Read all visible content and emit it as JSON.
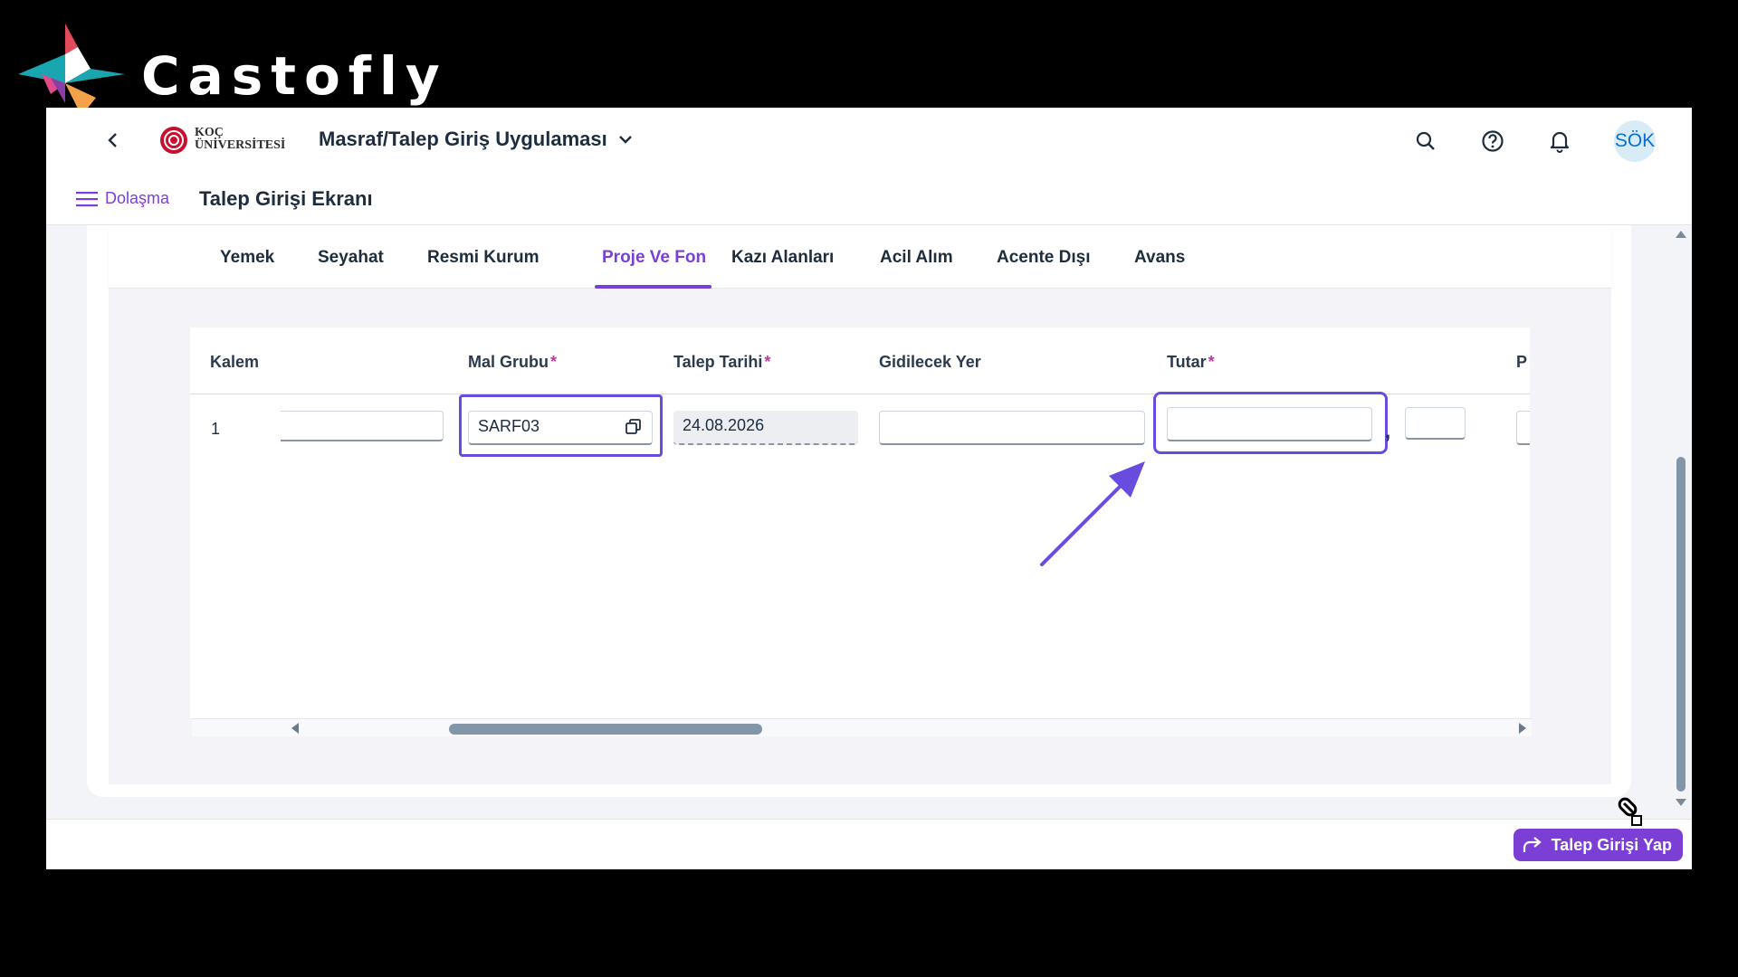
{
  "brand": {
    "name": "Castofly"
  },
  "shellbar": {
    "logo_text_line1": "KOÇ",
    "logo_text_line2": "ÜNİVERSİTESİ",
    "app_title": "Masraf/Talep Giriş Uygulaması",
    "avatar_initials": "SÖK",
    "icons": [
      "back-icon",
      "search-icon",
      "help-icon",
      "bell-icon",
      "chevron-down-icon"
    ]
  },
  "subbar": {
    "nav_label": "Dolaşma",
    "page_title": "Talep Girişi Ekranı"
  },
  "tabs": [
    {
      "label": "Yemek",
      "active": false
    },
    {
      "label": "Seyahat",
      "active": false
    },
    {
      "label": "Resmi Kurum",
      "active": false
    },
    {
      "label": "Proje Ve Fon",
      "active": true
    },
    {
      "label": "Kazı Alanları",
      "active": false
    },
    {
      "label": "Acil Alım",
      "active": false
    },
    {
      "label": "Acente Dışı",
      "active": false
    },
    {
      "label": "Avans",
      "active": false
    }
  ],
  "table": {
    "columns": [
      {
        "label": "Kalem",
        "required": false
      },
      {
        "label": "Mal Grubu",
        "required": true
      },
      {
        "label": "Talep Tarihi",
        "required": true
      },
      {
        "label": "Gidilecek Yer",
        "required": false
      },
      {
        "label": "Tutar",
        "required": true
      },
      {
        "label": "P",
        "required": false
      }
    ],
    "required_mark": "*",
    "rows": [
      {
        "kalem": "1",
        "mal_grubu": "SARF03",
        "talep_tarihi": "24.08.2026",
        "gidilecek_yer": "",
        "tutar": "",
        "currency": ""
      }
    ],
    "separator": ","
  },
  "footer": {
    "primary_action": "Talep Girişi Yap"
  },
  "colors": {
    "accent": "#7b3fd6",
    "highlight": "#6a4be0",
    "required": "#c0399f",
    "avatar_bg": "#d8ecf8",
    "avatar_text": "#0a6ed1"
  }
}
